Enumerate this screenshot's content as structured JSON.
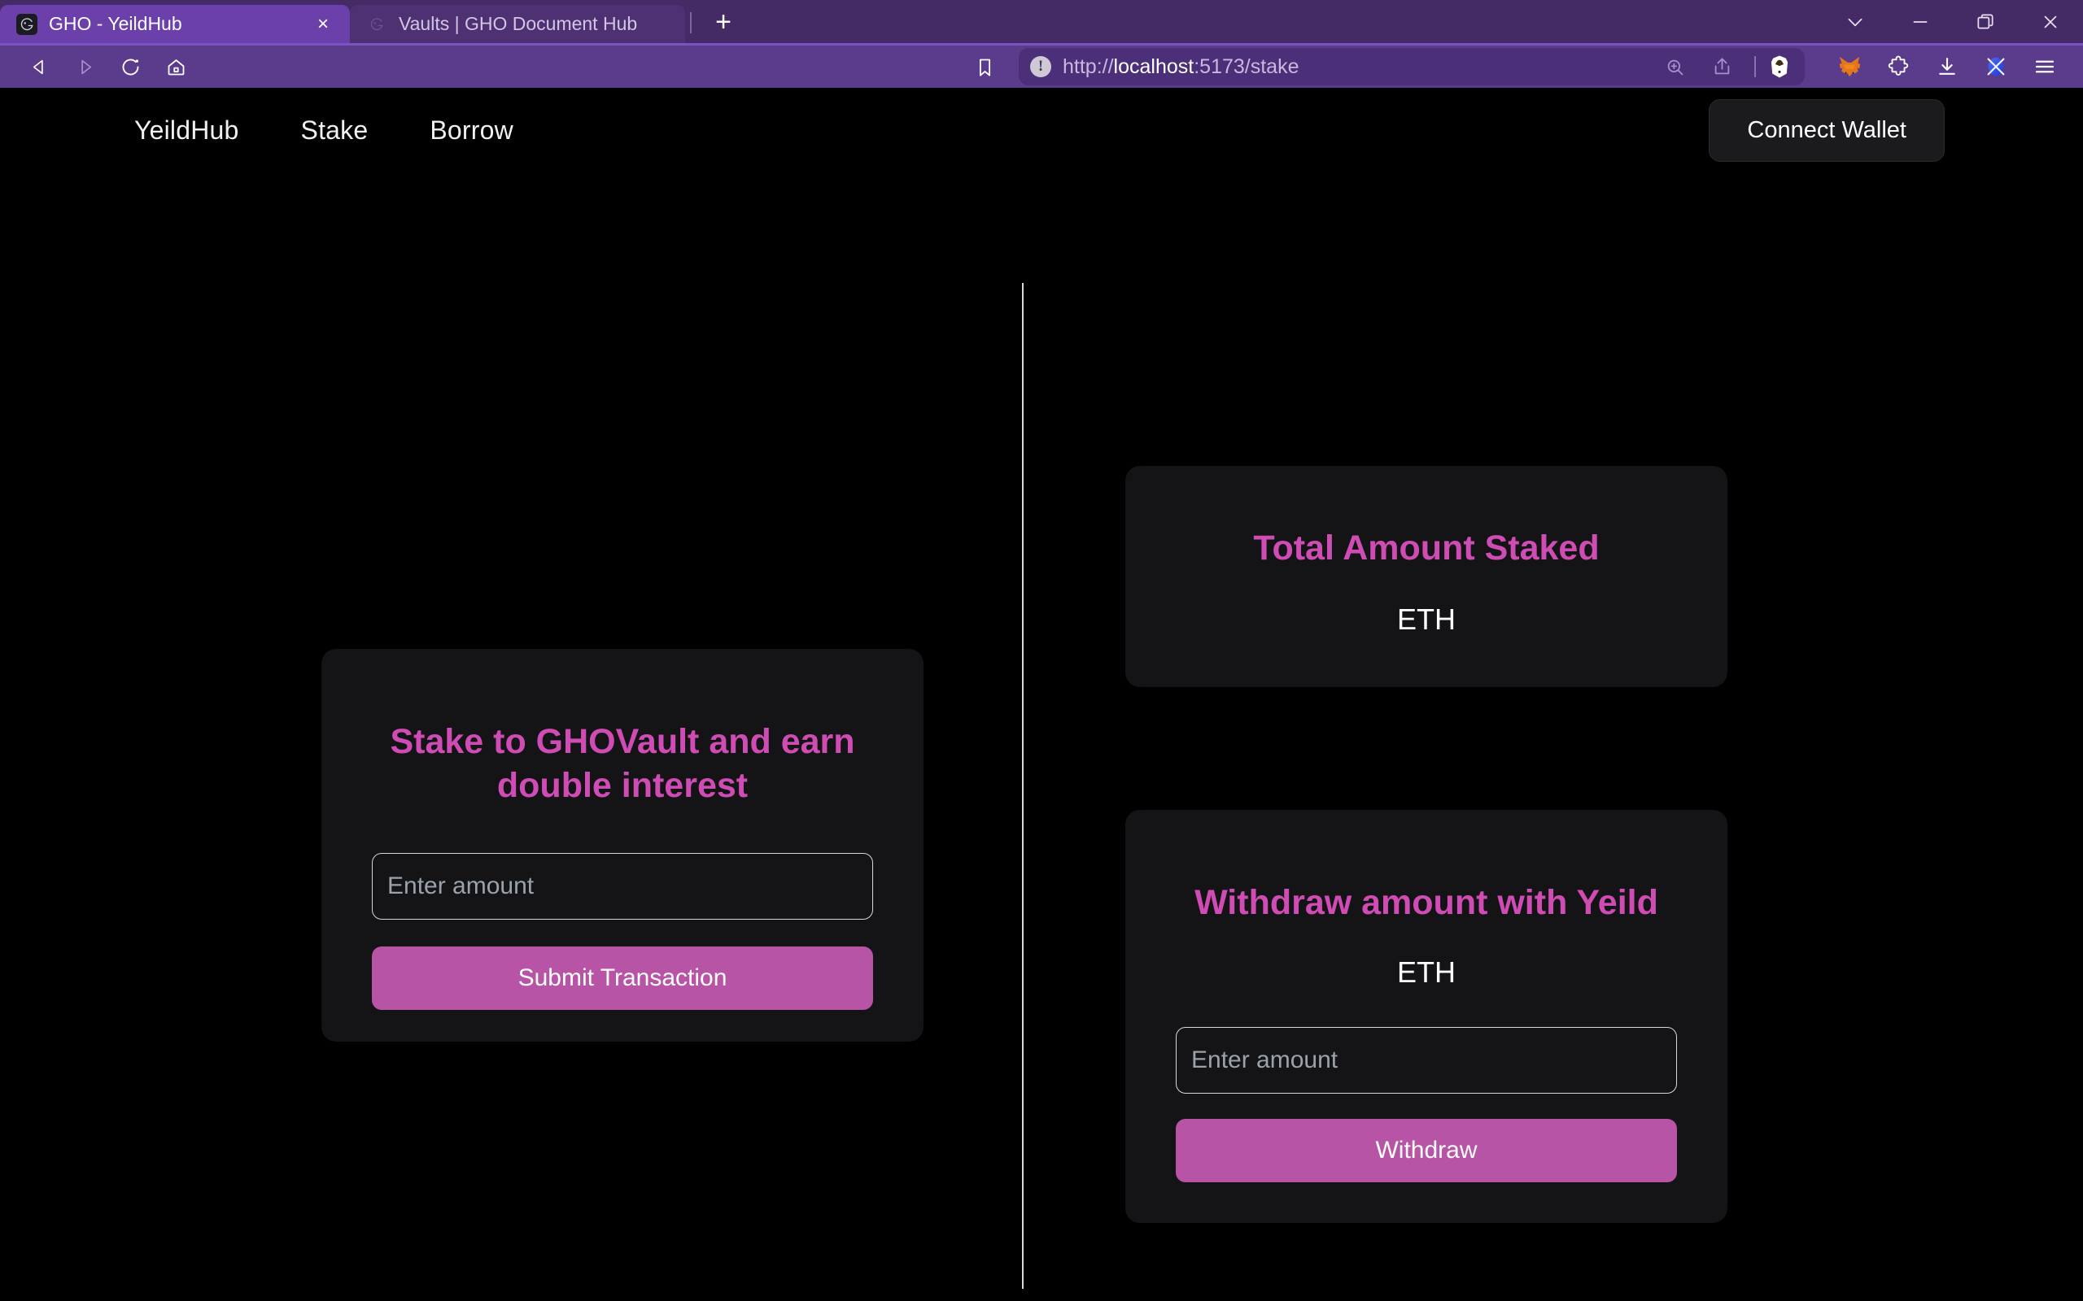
{
  "browser": {
    "tabs": [
      {
        "title": "GHO - YeildHub",
        "favicon": "gho-logo-icon",
        "active": true,
        "close_label": "×"
      },
      {
        "title": "Vaults | GHO Document Hub",
        "favicon": "gho-logo-icon",
        "active": false
      }
    ],
    "new_tab_label": "+",
    "window_controls": [
      "tab-search-chevron-icon",
      "minimize-icon",
      "restore-icon",
      "close-icon"
    ],
    "nav_icons": [
      "back-icon",
      "forward-icon",
      "reload-icon",
      "home-icon",
      "bookmark-icon"
    ],
    "url": {
      "scheme": "http://",
      "host": "localhost",
      "rest": ":5173/stake",
      "full": "http://localhost:5173/stake",
      "security_glyph": "!"
    },
    "url_actions": [
      "zoom-in-icon",
      "share-icon",
      "brave-shields-lion-icon"
    ],
    "extension_icons": [
      "metamask-fox-icon",
      "extensions-puzzle-icon",
      "downloads-icon",
      "brave-wallet-icon",
      "browser-menu-icon"
    ],
    "colors": {
      "tabstrip_bg": "#452b66",
      "active_tab_bg": "#6b40aa",
      "inactive_tab_bg": "#4e3173",
      "toolbar_bg": "#5a3b8c",
      "urlbar_bg": "#4b2f78"
    }
  },
  "app": {
    "nav": {
      "brand": "YeildHub",
      "links": [
        {
          "label": "YeildHub"
        },
        {
          "label": "Stake"
        },
        {
          "label": "Borrow"
        }
      ],
      "connect_wallet_label": "Connect Wallet"
    },
    "stake_card": {
      "heading": "Stake to GHOVault and earn double interest",
      "input_placeholder": "Enter amount",
      "input_value": "",
      "submit_label": "Submit Transaction"
    },
    "total_staked_card": {
      "heading": "Total Amount Staked",
      "amount": "",
      "unit": "ETH"
    },
    "withdraw_card": {
      "heading": "Withdraw amount with Yeild",
      "amount": "",
      "unit": "ETH",
      "input_placeholder": "Enter amount",
      "input_value": "",
      "withdraw_label": "Withdraw"
    },
    "colors": {
      "page_bg": "#000000",
      "card_bg": "#141316",
      "accent_heading": "#cf4cb4",
      "accent_button": "#b854a6",
      "text_primary": "#ffffff",
      "placeholder": "#9aa3ab",
      "divider": "#d9d9d9"
    }
  }
}
